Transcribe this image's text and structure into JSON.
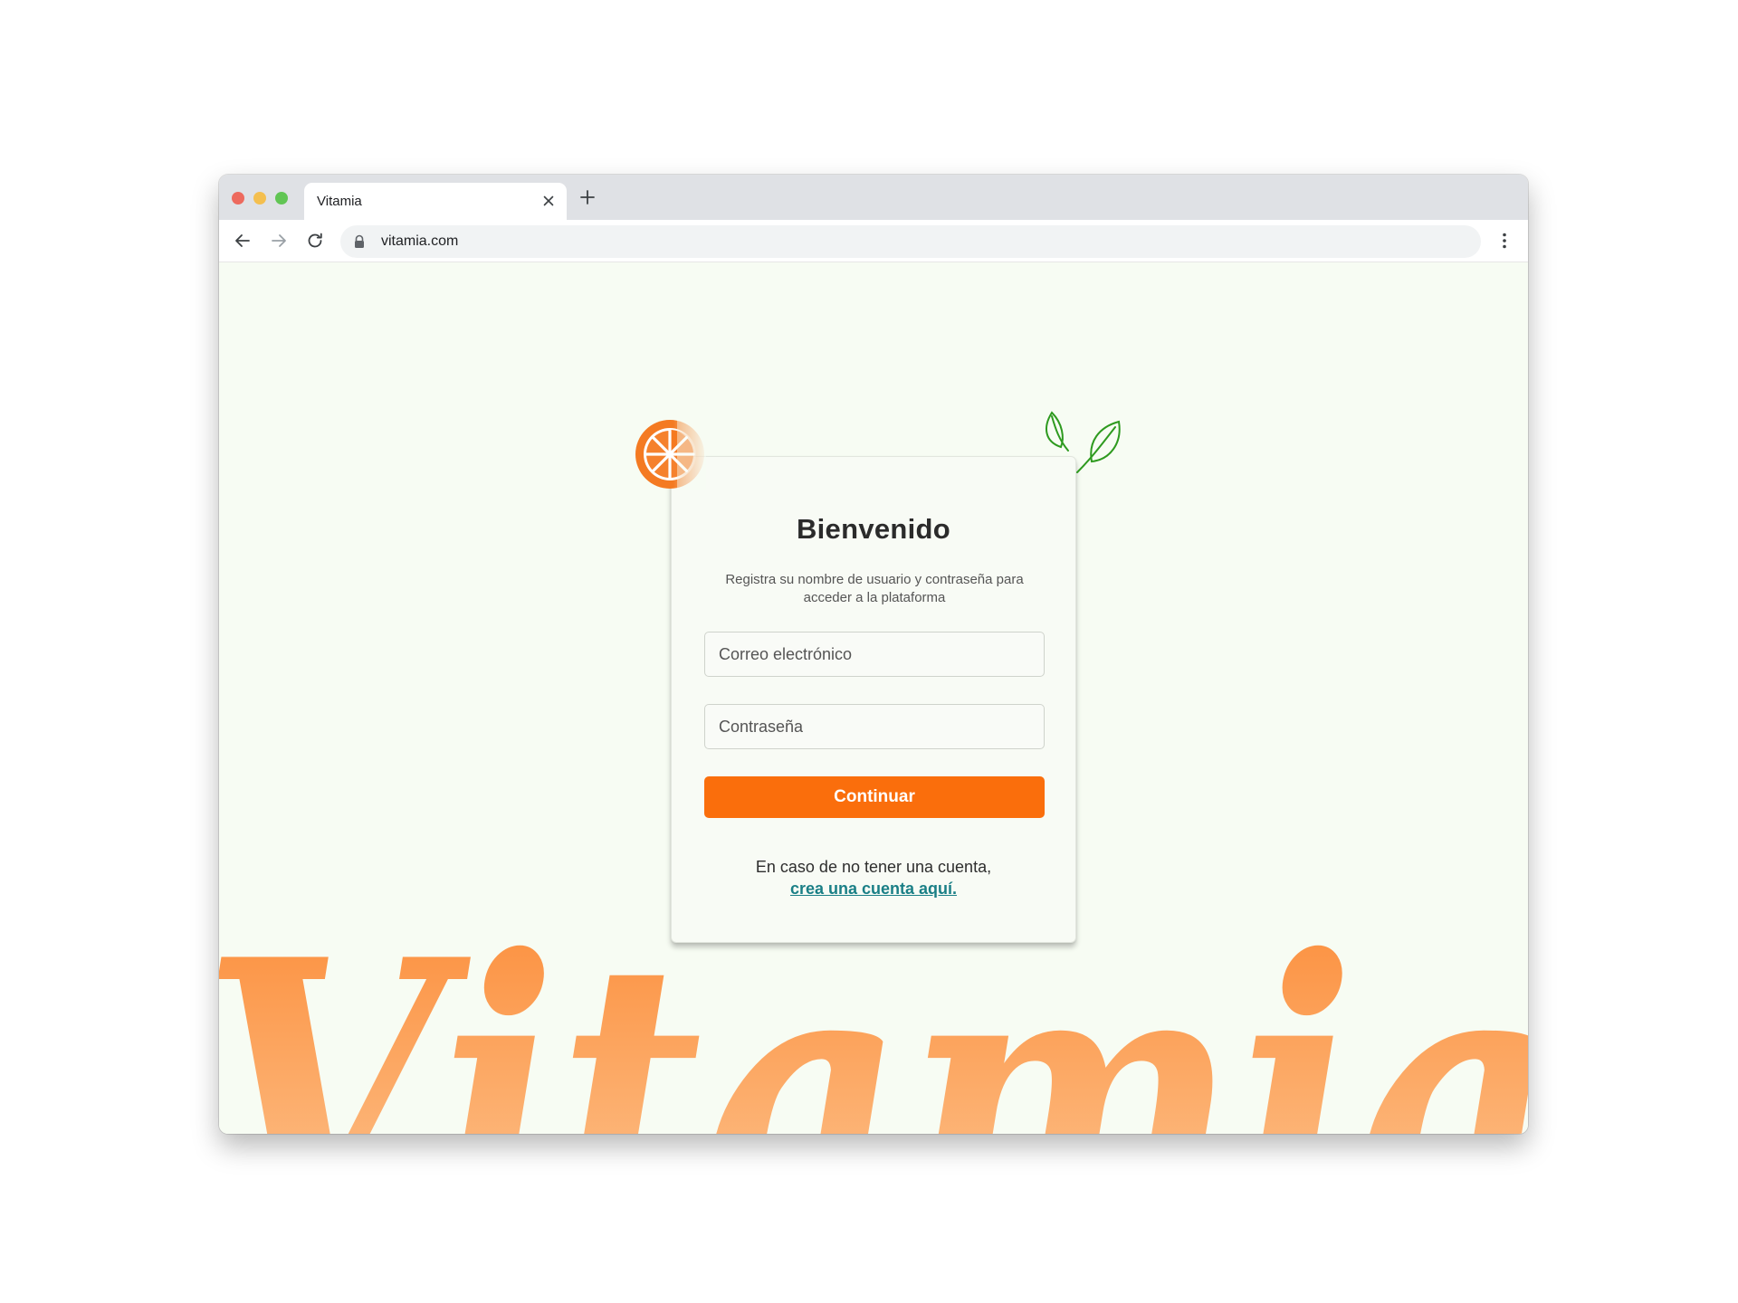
{
  "browser": {
    "tab_title": "Vitamia",
    "url": "vitamia.com"
  },
  "login": {
    "title": "Bienvenido",
    "subtitle": "Registra su nombre de usuario y contraseña para acceder a la plataforma",
    "email_placeholder": "Correo electrónico",
    "password_placeholder": "Contraseña",
    "continue_label": "Continuar",
    "footer_text": "En caso de no tener una cuenta,",
    "signup_link": "crea una cuenta aquí."
  },
  "brand": {
    "wordmark": "Vitamia",
    "accent": "#fa6e0c",
    "link_color": "#1a7f86",
    "leaf_color": "#2e9a1f",
    "background": "#f7fcf3"
  },
  "icons": {
    "orange": "orange-slice-icon",
    "leaves": "leaves-icon"
  }
}
